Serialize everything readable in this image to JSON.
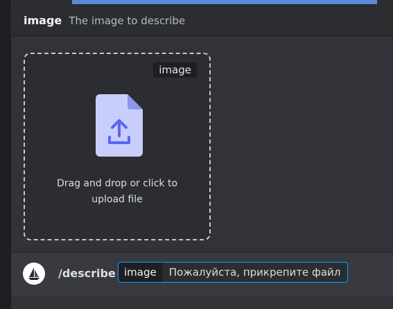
{
  "option_header": {
    "name": "image",
    "description": "The image to describe"
  },
  "dropzone": {
    "tag": "image",
    "text_line1": "Drag and drop or click to",
    "text_line2": "upload file",
    "icon": "file-upload-icon"
  },
  "command_bar": {
    "bot_avatar_icon": "sailboat-icon",
    "command": "/describe",
    "option_name": "image",
    "option_value": "Пожалуйста, прикрепите файл"
  },
  "colors": {
    "accent": "#00a8fc",
    "file_icon": "#c9cdfb",
    "upload_arrow": "#5865f2"
  }
}
